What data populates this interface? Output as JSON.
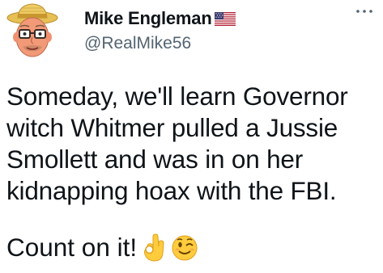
{
  "user": {
    "display_name": "Mike Engleman",
    "handle": "@RealMike56",
    "flag_icon": "us-flag-icon",
    "avatar_icon": "cartoon-man-hat-glasses-avatar"
  },
  "menu": {
    "icon": "more-options-icon"
  },
  "tweet": {
    "text_lines": "Someday, we'll learn Governor\nwitch Whitmer pulled a Jussie\nSmollett and was in on her\nkidnapping hoax with the FBI.",
    "closing": "Count on it!",
    "emojis": [
      "ok-hand-icon",
      "winking-face-icon"
    ]
  },
  "colors": {
    "text": "#0f1419",
    "secondary": "#536471",
    "hat": "#e8c35a",
    "skin": "#f4a07e",
    "emoji_yellow": "#ffcc3e"
  }
}
